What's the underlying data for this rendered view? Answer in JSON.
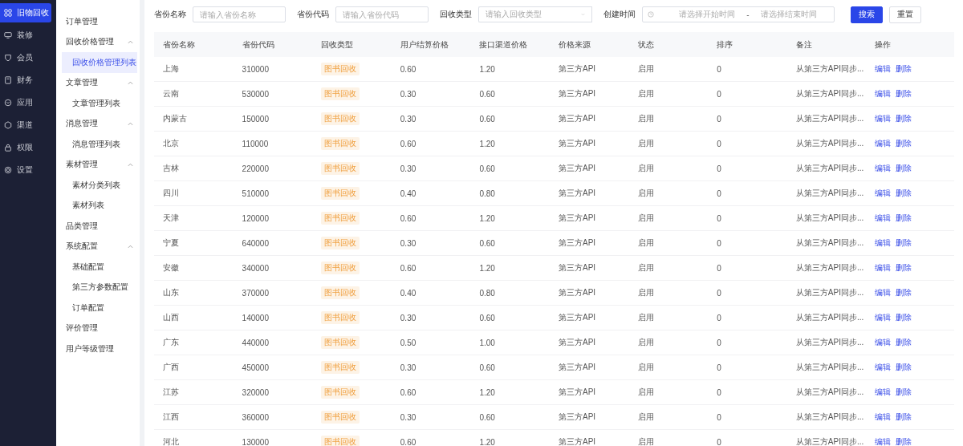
{
  "nav": [
    {
      "label": "旧物回收",
      "selected": true
    },
    {
      "label": "装修",
      "selected": false
    },
    {
      "label": "会员",
      "selected": false
    },
    {
      "label": "财务",
      "selected": false
    },
    {
      "label": "应用",
      "selected": false
    },
    {
      "label": "渠道",
      "selected": false
    },
    {
      "label": "权限",
      "selected": false
    },
    {
      "label": "设置",
      "selected": false
    }
  ],
  "submenu": [
    {
      "label": "订单管理",
      "selected": false
    },
    {
      "label": "回收价格管理",
      "expanded": true,
      "children": [
        {
          "label": "回收价格管理列表",
          "selected": true
        }
      ]
    },
    {
      "label": "文章管理",
      "expanded": true,
      "children": [
        {
          "label": "文章管理列表",
          "selected": false
        }
      ]
    },
    {
      "label": "消息管理",
      "expanded": true,
      "children": [
        {
          "label": "消息管理列表",
          "selected": false
        }
      ]
    },
    {
      "label": "素材管理",
      "expanded": true,
      "children": [
        {
          "label": "素材分类列表",
          "selected": false
        },
        {
          "label": "素材列表",
          "selected": false
        }
      ]
    },
    {
      "label": "品类管理",
      "selected": false
    },
    {
      "label": "系统配置",
      "expanded": true,
      "children": [
        {
          "label": "基础配置",
          "selected": false
        },
        {
          "label": "第三方参数配置",
          "selected": false
        },
        {
          "label": "订单配置",
          "selected": false
        }
      ]
    },
    {
      "label": "评价管理",
      "selected": false
    },
    {
      "label": "用户等级管理",
      "selected": false
    }
  ],
  "filters": [
    {
      "kind": "text",
      "label": "省份名称",
      "placeholder": "请输入省份名称"
    },
    {
      "kind": "text",
      "label": "省份代码",
      "placeholder": "请输入省份代码"
    },
    {
      "kind": "select",
      "label": "回收类型",
      "placeholder": "请输入回收类型"
    },
    {
      "kind": "daterange",
      "label": "创建时间",
      "start_placeholder": "请选择开始时间",
      "separator": "-",
      "end_placeholder": "请选择结束时间"
    }
  ],
  "buttons": [
    {
      "label": "搜索",
      "kind": "primary"
    },
    {
      "label": "重置",
      "kind": "default"
    }
  ],
  "table": {
    "columns": [
      "省份名称",
      "省份代码",
      "回收类型",
      "用户结算价格",
      "接口渠道价格",
      "价格来源",
      "状态",
      "排序",
      "备注",
      "操作"
    ],
    "rows": [
      [
        "上海",
        "310000",
        "图书回收",
        "0.60",
        "1.20",
        "第三方API",
        "启用",
        "0",
        "从第三方API同步..."
      ],
      [
        "云南",
        "530000",
        "图书回收",
        "0.30",
        "0.60",
        "第三方API",
        "启用",
        "0",
        "从第三方API同步..."
      ],
      [
        "内蒙古",
        "150000",
        "图书回收",
        "0.30",
        "0.60",
        "第三方API",
        "启用",
        "0",
        "从第三方API同步..."
      ],
      [
        "北京",
        "110000",
        "图书回收",
        "0.60",
        "1.20",
        "第三方API",
        "启用",
        "0",
        "从第三方API同步..."
      ],
      [
        "吉林",
        "220000",
        "图书回收",
        "0.30",
        "0.60",
        "第三方API",
        "启用",
        "0",
        "从第三方API同步..."
      ],
      [
        "四川",
        "510000",
        "图书回收",
        "0.40",
        "0.80",
        "第三方API",
        "启用",
        "0",
        "从第三方API同步..."
      ],
      [
        "天津",
        "120000",
        "图书回收",
        "0.60",
        "1.20",
        "第三方API",
        "启用",
        "0",
        "从第三方API同步..."
      ],
      [
        "宁夏",
        "640000",
        "图书回收",
        "0.30",
        "0.60",
        "第三方API",
        "启用",
        "0",
        "从第三方API同步..."
      ],
      [
        "安徽",
        "340000",
        "图书回收",
        "0.60",
        "1.20",
        "第三方API",
        "启用",
        "0",
        "从第三方API同步..."
      ],
      [
        "山东",
        "370000",
        "图书回收",
        "0.40",
        "0.80",
        "第三方API",
        "启用",
        "0",
        "从第三方API同步..."
      ],
      [
        "山西",
        "140000",
        "图书回收",
        "0.30",
        "0.60",
        "第三方API",
        "启用",
        "0",
        "从第三方API同步..."
      ],
      [
        "广东",
        "440000",
        "图书回收",
        "0.50",
        "1.00",
        "第三方API",
        "启用",
        "0",
        "从第三方API同步..."
      ],
      [
        "广西",
        "450000",
        "图书回收",
        "0.30",
        "0.60",
        "第三方API",
        "启用",
        "0",
        "从第三方API同步..."
      ],
      [
        "江苏",
        "320000",
        "图书回收",
        "0.60",
        "1.20",
        "第三方API",
        "启用",
        "0",
        "从第三方API同步..."
      ],
      [
        "江西",
        "360000",
        "图书回收",
        "0.30",
        "0.60",
        "第三方API",
        "启用",
        "0",
        "从第三方API同步..."
      ],
      [
        "河北",
        "130000",
        "图书回收",
        "0.60",
        "1.20",
        "第三方API",
        "启用",
        "0",
        "从第三方API同步..."
      ]
    ],
    "actions": [
      [
        "编辑",
        "删除"
      ],
      [
        "编辑",
        "删除"
      ],
      [
        "编辑",
        "删除"
      ],
      [
        "编辑",
        "删除"
      ],
      [
        "编辑",
        "删除"
      ],
      [
        "编辑",
        "删除"
      ],
      [
        "编辑",
        "删除"
      ],
      [
        "编辑",
        "删除"
      ],
      [
        "编辑",
        "删除"
      ],
      [
        "编辑",
        "删除"
      ],
      [
        "编辑",
        "删除"
      ],
      [
        "编辑",
        "删除"
      ],
      [
        "编辑",
        "删除"
      ],
      [
        "编辑",
        "删除"
      ],
      [
        "编辑",
        "删除"
      ],
      [
        "编辑",
        "删除"
      ]
    ]
  }
}
